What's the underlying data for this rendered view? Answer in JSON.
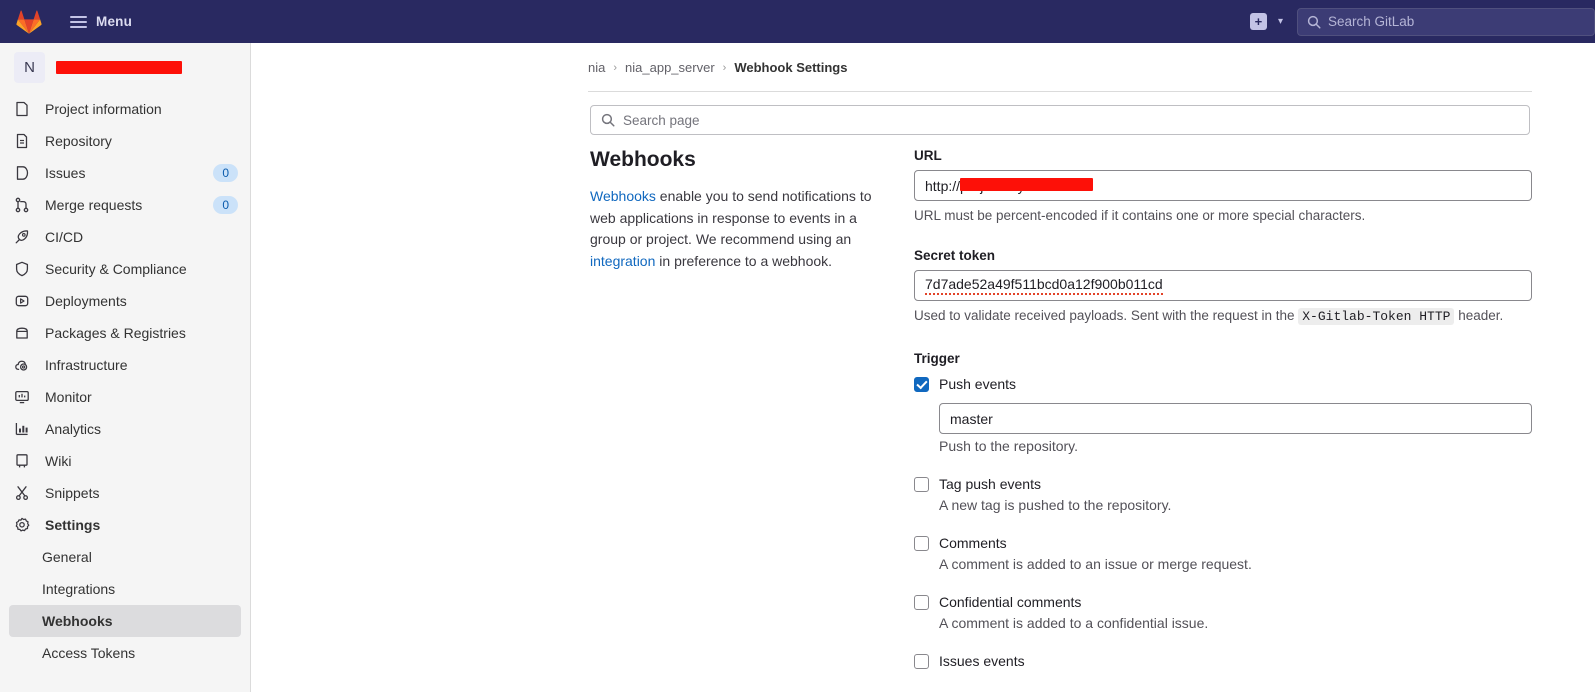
{
  "navbar": {
    "logo_icon": "gitlab-logo-icon",
    "menu_label": "Menu",
    "plus_icon": "plus-square-icon",
    "caret_icon": "chevron-down-icon",
    "search_icon": "search-icon",
    "search_placeholder": "Search GitLab"
  },
  "sidebar": {
    "project": {
      "avatar_initial": "N",
      "name_redacted": true,
      "name": ""
    },
    "items": [
      {
        "label": "Project information",
        "icon": "book-icon",
        "badge": null
      },
      {
        "label": "Repository",
        "icon": "document-icon",
        "badge": null
      },
      {
        "label": "Issues",
        "icon": "issue-icon",
        "badge": "0"
      },
      {
        "label": "Merge requests",
        "icon": "merge-request-icon",
        "badge": "0"
      },
      {
        "label": "CI/CD",
        "icon": "rocket-icon",
        "badge": null
      },
      {
        "label": "Security & Compliance",
        "icon": "shield-icon",
        "badge": null
      },
      {
        "label": "Deployments",
        "icon": "deployment-icon",
        "badge": null
      },
      {
        "label": "Packages & Registries",
        "icon": "package-icon",
        "badge": null
      },
      {
        "label": "Infrastructure",
        "icon": "cloud-gear-icon",
        "badge": null
      },
      {
        "label": "Monitor",
        "icon": "monitor-icon",
        "badge": null
      },
      {
        "label": "Analytics",
        "icon": "chart-icon",
        "badge": null
      },
      {
        "label": "Wiki",
        "icon": "book-open-icon",
        "badge": null
      },
      {
        "label": "Snippets",
        "icon": "scissors-icon",
        "badge": null
      },
      {
        "label": "Settings",
        "icon": "gear-icon",
        "badge": null,
        "bold": true
      }
    ],
    "settings_subitems": [
      {
        "label": "General",
        "active": false
      },
      {
        "label": "Integrations",
        "active": false
      },
      {
        "label": "Webhooks",
        "active": true
      },
      {
        "label": "Access Tokens",
        "active": false
      }
    ]
  },
  "breadcrumb": {
    "items": [
      "nia",
      "nia_app_server"
    ],
    "current": "Webhook Settings",
    "separator": "›"
  },
  "page_search": {
    "icon": "search-icon",
    "placeholder": "Search page"
  },
  "webhooks_info": {
    "heading": "Webhooks",
    "link1": "Webhooks",
    "text1": " enable you to send notifications to web applications in response to events in a group or project. We recommend using an ",
    "link2": "integration",
    "text2": " in preference to a webhook."
  },
  "form": {
    "url": {
      "label": "URL",
      "value_prefix": "http://",
      "value_suffix": "project/my-cicd",
      "redacted": true,
      "help": "URL must be percent-encoded if it contains one or more special characters."
    },
    "secret_token": {
      "label": "Secret token",
      "value": "7d7ade52a49f511bcd0a12f900b011cd",
      "help_before": "Used to validate received payloads. Sent with the request in the ",
      "help_code": "X-Gitlab-Token HTTP",
      "help_after": " header."
    },
    "trigger": {
      "label": "Trigger",
      "options": [
        {
          "label": "Push events",
          "checked": true,
          "branch_value": "master",
          "desc": "Push to the repository."
        },
        {
          "label": "Tag push events",
          "checked": false,
          "desc": "A new tag is pushed to the repository."
        },
        {
          "label": "Comments",
          "checked": false,
          "desc": "A comment is added to an issue or merge request."
        },
        {
          "label": "Confidential comments",
          "checked": false,
          "desc": "A comment is added to a confidential issue."
        },
        {
          "label": "Issues events",
          "checked": false,
          "desc": ""
        }
      ]
    }
  },
  "colors": {
    "navbar_bg": "#292961",
    "sidebar_bg": "#f5f5f5",
    "accent_blue": "#1068bf",
    "badge_bg": "#cbe2f9",
    "redaction_red": "#fd1008"
  }
}
